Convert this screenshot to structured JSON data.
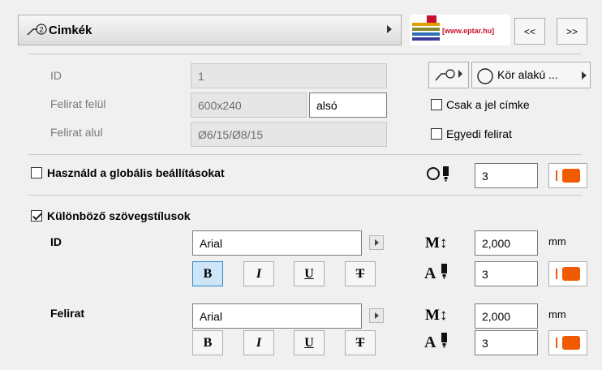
{
  "header": {
    "title": "Cimkék",
    "logo_text": "[www.eptar.hu]"
  },
  "nav": {
    "prev": "<<",
    "next": ">>"
  },
  "fields": {
    "id_label": "ID",
    "id_value": "1",
    "top_label": "Felirat felül",
    "top_value": "600x240",
    "top_pos": "alsó",
    "bottom_label": "Felirat alul",
    "bottom_value": "Ø6/15/Ø8/15"
  },
  "marker": {
    "shape_label": "Kör alakú ..."
  },
  "checks": {
    "only_marker": "Csak a jel címke",
    "custom_text": "Egyedi felirat",
    "global": "Használd a globális beállításokat",
    "different_styles": "Különböző szövegstílusok"
  },
  "global_pen": "3",
  "styles": {
    "id": {
      "label": "ID",
      "font": "Arial",
      "size": "2,000",
      "unit": "mm",
      "pen": "3"
    },
    "text": {
      "label": "Felirat",
      "font": "Arial",
      "size": "2,000",
      "unit": "mm",
      "pen": "3"
    }
  },
  "format_buttons": [
    "B",
    "I",
    "U",
    "T"
  ],
  "colors": {
    "accent": "#f05a00",
    "active": "#cde6f7"
  }
}
